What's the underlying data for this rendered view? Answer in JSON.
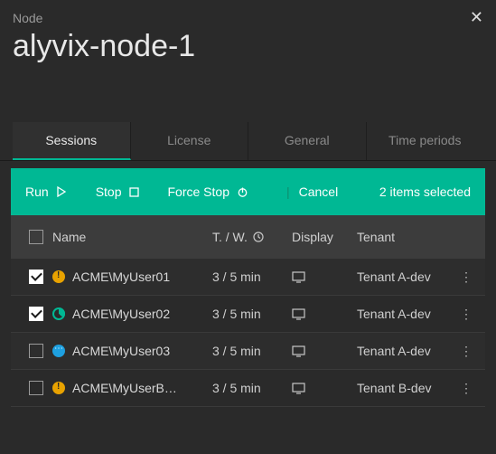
{
  "header": {
    "label": "Node",
    "title": "alyvix-node-1"
  },
  "tabs": [
    {
      "label": "Sessions",
      "active": true
    },
    {
      "label": "License",
      "active": false
    },
    {
      "label": "General",
      "active": false
    },
    {
      "label": "Time periods",
      "active": false
    }
  ],
  "toolbar": {
    "run": "Run",
    "stop": "Stop",
    "force_stop": "Force Stop",
    "cancel": "Cancel",
    "selection": "2 items selected"
  },
  "columns": {
    "name": "Name",
    "tw": "T. / W.",
    "display": "Display",
    "tenant": "Tenant"
  },
  "rows": [
    {
      "checked": true,
      "status": "warn",
      "name": "ACME\\MyUser01",
      "tw": "3 / 5 min",
      "tenant": "Tenant A-dev"
    },
    {
      "checked": true,
      "status": "ok",
      "name": "ACME\\MyUser02",
      "tw": "3 / 5 min",
      "tenant": "Tenant A-dev"
    },
    {
      "checked": false,
      "status": "busy",
      "name": "ACME\\MyUser03",
      "tw": "3 / 5 min",
      "tenant": "Tenant A-dev"
    },
    {
      "checked": false,
      "status": "warn",
      "name": "ACME\\MyUserB…",
      "tw": "3 / 5 min",
      "tenant": "Tenant B-dev"
    }
  ]
}
